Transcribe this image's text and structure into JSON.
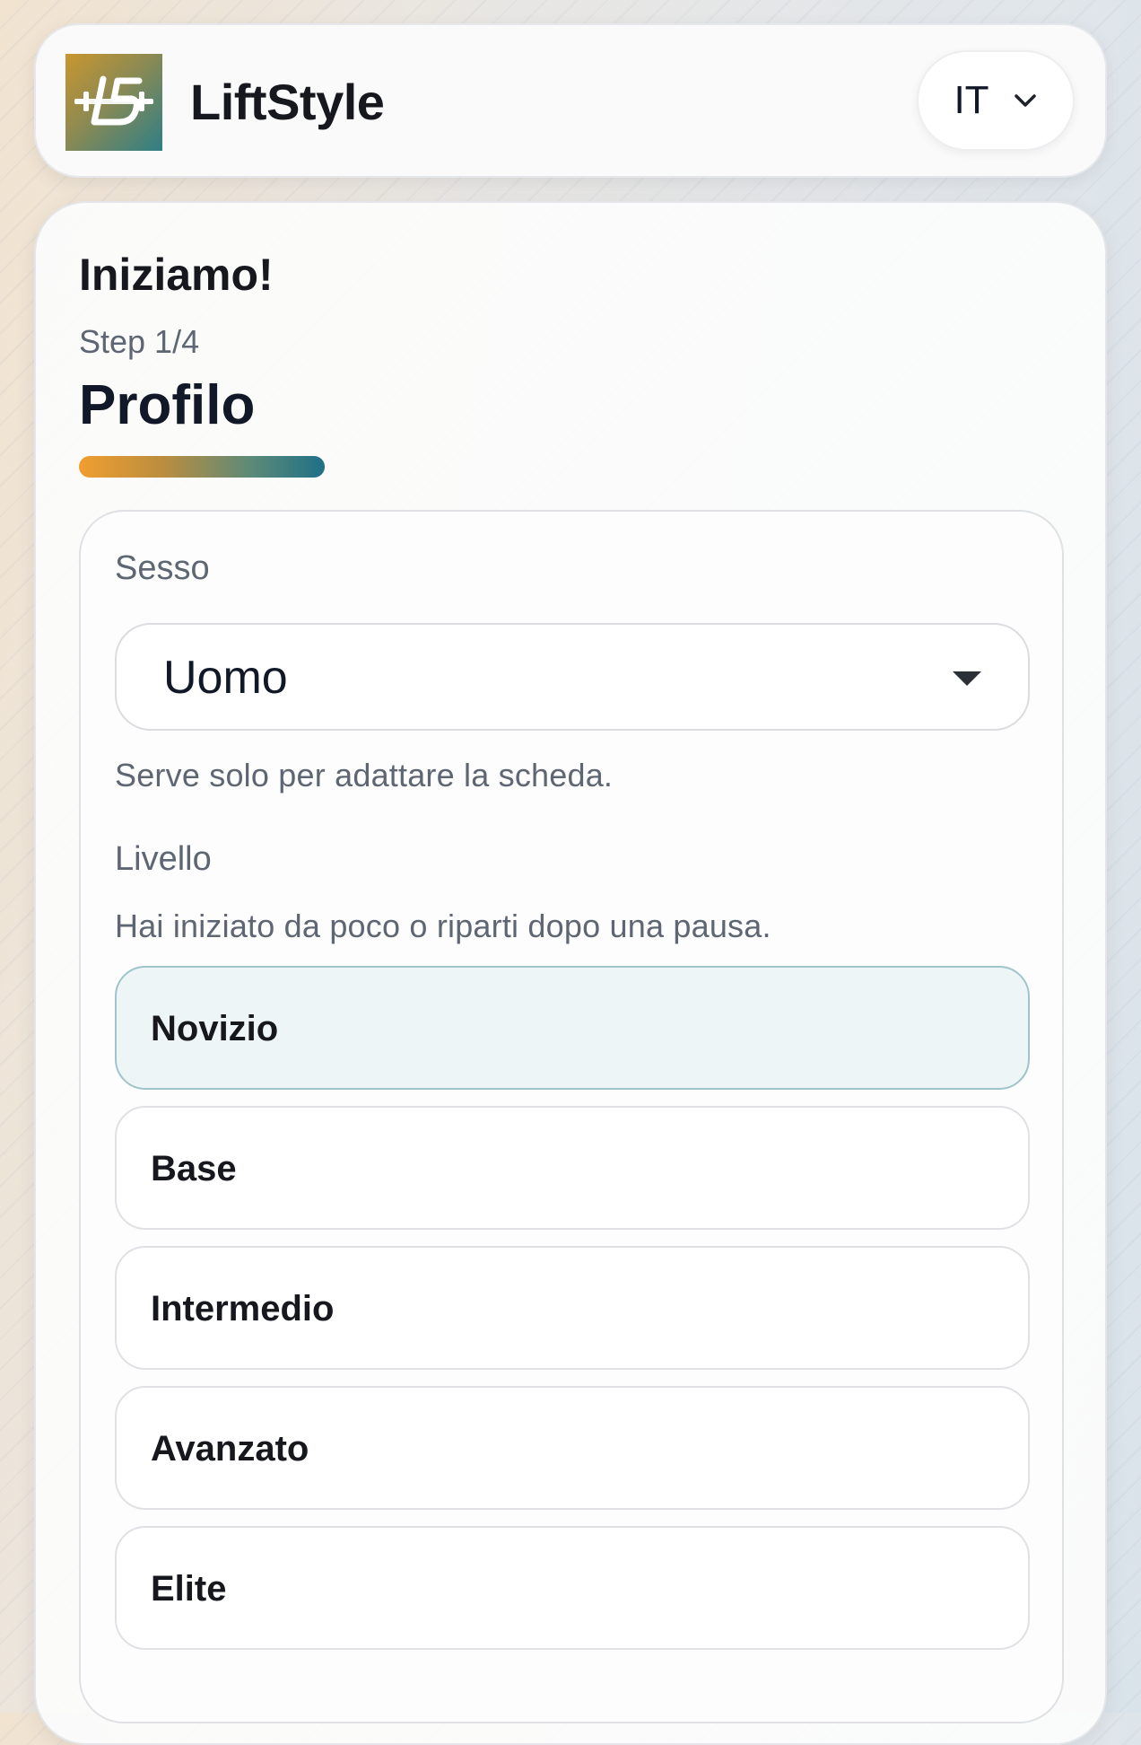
{
  "header": {
    "brand": "LiftStyle",
    "language": "IT"
  },
  "card": {
    "title": "Iniziamo!",
    "step": "Step 1/4",
    "step_title": "Profilo",
    "progress": 0.25
  },
  "form": {
    "sex": {
      "label": "Sesso",
      "value": "Uomo",
      "hint": "Serve solo per adattare la scheda."
    },
    "level": {
      "label": "Livello",
      "hint": "Hai iniziato da poco o riparti dopo una pausa.",
      "options": [
        "Novizio",
        "Base",
        "Intermedio",
        "Avanzato",
        "Elite"
      ],
      "selected": "Novizio"
    }
  },
  "colors": {
    "selected_option_bg": "#eef5f7",
    "selected_option_border": "#9fc4cc",
    "progress_start": "#f09e2f",
    "progress_end": "#1f7088"
  },
  "icons": {
    "logo": "liftstyle-logo-icon",
    "language_chevron": "chevron-down-icon",
    "select_caret": "caret-down-icon"
  }
}
